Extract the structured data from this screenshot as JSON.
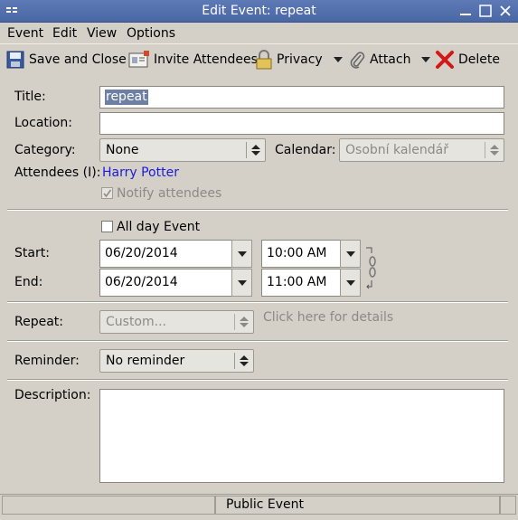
{
  "window": {
    "title": "Edit Event: repeat"
  },
  "menu": [
    "Event",
    "Edit",
    "View",
    "Options"
  ],
  "toolbar": {
    "save_close": "Save and Close",
    "invite": "Invite Attendees",
    "privacy": "Privacy",
    "attach": "Attach",
    "delete": "Delete"
  },
  "form": {
    "title_label": "Title:",
    "title_value": "repeat",
    "location_label": "Location:",
    "location_value": "",
    "category_label": "Category:",
    "category_value": "None",
    "calendar_label": "Calendar:",
    "calendar_value": "Osobní kalendář",
    "attendees_label": "Attendees (I):",
    "attendees_value": "Harry Potter",
    "notify_label": "Notify attendees",
    "notify_checked": true,
    "allday_label": "All day Event",
    "allday_checked": false,
    "start_label": "Start:",
    "start_date": "06/20/2014",
    "start_time": "10:00 AM",
    "end_label": "End:",
    "end_date": "06/20/2014",
    "end_time": "11:00 AM",
    "repeat_label": "Repeat:",
    "repeat_value": "Custom...",
    "repeat_details": "Click here for details",
    "reminder_label": "Reminder:",
    "reminder_value": "No reminder",
    "description_label": "Description:",
    "description_value": ""
  },
  "status": {
    "privacy": "Public Event"
  }
}
